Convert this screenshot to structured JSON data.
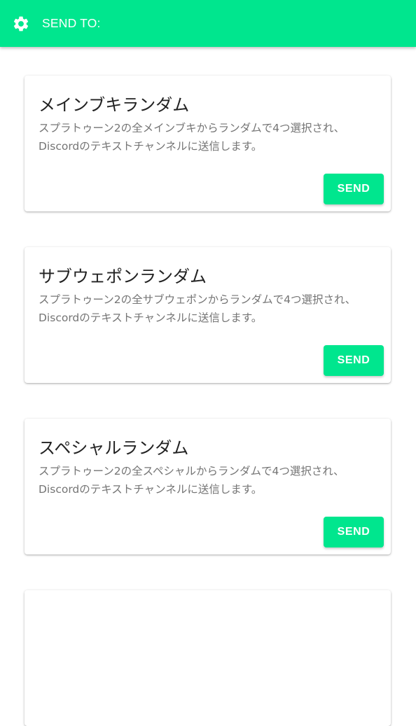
{
  "appbar": {
    "title": "SEND TO:",
    "icon": "gear-icon",
    "color": "#00e68e"
  },
  "cards": [
    {
      "title": "メインブキランダム",
      "description": "スプラトゥーン2の全メインブキからランダムで4つ選択され、 Discordのテキストチャンネルに送信します。",
      "button": "SEND"
    },
    {
      "title": "サブウェポンランダム",
      "description": "スプラトゥーン2の全サブウェポンからランダムで4つ選択され、 Discordのテキストチャンネルに送信します。",
      "button": "SEND"
    },
    {
      "title": "スペシャルランダム",
      "description": "スプラトゥーン2の全スペシャルからランダムで4つ選択され、 Discordのテキストチャンネルに送信します。",
      "button": "SEND"
    },
    {
      "title": "",
      "description": "",
      "button": ""
    }
  ],
  "theme": {
    "accent": "#00e68e",
    "title_text": "#222222",
    "body_text": "#757575"
  }
}
